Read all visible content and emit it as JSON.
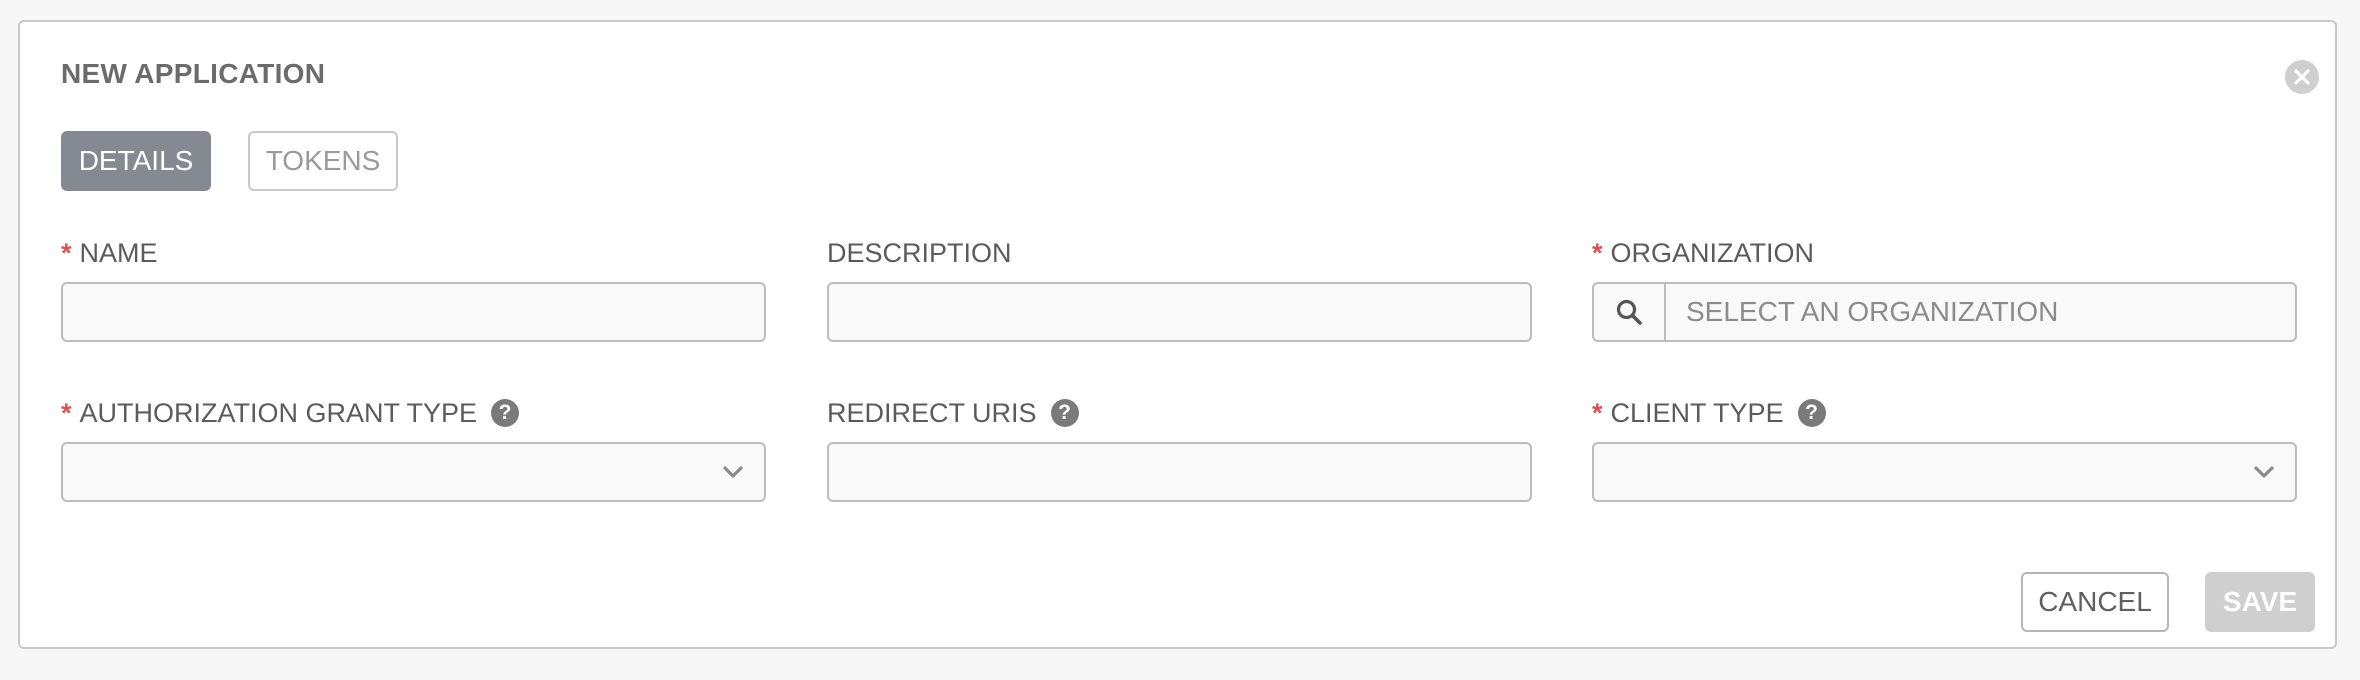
{
  "dialog": {
    "title": "NEW APPLICATION"
  },
  "tabs": [
    {
      "label": "DETAILS",
      "active": true
    },
    {
      "label": "TOKENS",
      "active": false
    }
  ],
  "form": {
    "name": {
      "label": "NAME",
      "required": true,
      "value": ""
    },
    "description": {
      "label": "DESCRIPTION",
      "required": false,
      "value": ""
    },
    "organization": {
      "label": "ORGANIZATION",
      "required": true,
      "placeholder": "SELECT AN ORGANIZATION"
    },
    "grant_type": {
      "label": "AUTHORIZATION GRANT TYPE",
      "required": true,
      "value": "",
      "help_icon": "question-circle-icon"
    },
    "redirect_uris": {
      "label": "REDIRECT URIS",
      "required": false,
      "value": "",
      "help_icon": "question-circle-icon"
    },
    "client_type": {
      "label": "CLIENT TYPE",
      "required": true,
      "value": "",
      "help_icon": "question-circle-icon"
    }
  },
  "required_mark": "*",
  "help_mark": "?",
  "actions": {
    "cancel_label": "CANCEL",
    "save_label": "SAVE"
  },
  "colors": {
    "required": "#d9534f",
    "active_tab": "#848992",
    "save_disabled": "#cfcfcf"
  }
}
